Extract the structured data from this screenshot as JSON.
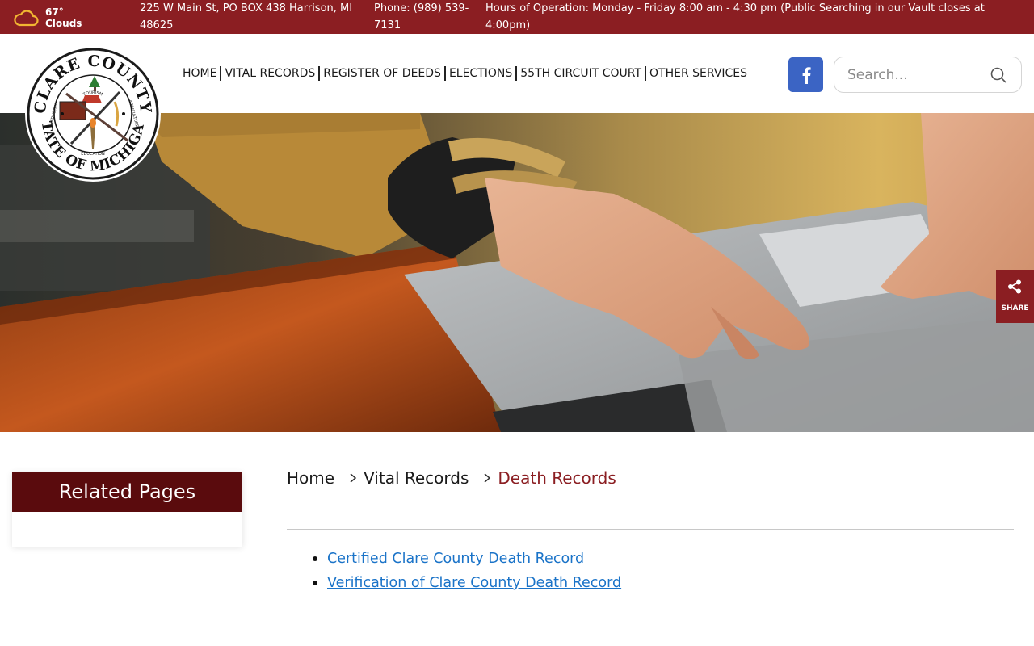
{
  "topbar": {
    "weather": {
      "temp": "67°",
      "condition": "Clouds",
      "icon": "cloud-icon"
    },
    "address": "225 W Main St, PO BOX 438 Harrison, MI 48625",
    "phone": "Phone: (989) 539-7131",
    "hours": "Hours of Operation: Monday - Friday 8:00 am - 4:30 pm  (Public Searching in our Vault closes at 4:00pm)"
  },
  "seal": {
    "top_text": "CLARE COUNTY",
    "bottom_text": "STATE OF MICHIGAN",
    "inner_words": [
      "TOURISM",
      "INDUSTRY",
      "AGRICULTURE",
      "EDUCATION"
    ]
  },
  "nav": {
    "items": [
      "HOME",
      "VITAL RECORDS",
      "REGISTER OF DEEDS",
      "ELECTIONS",
      "55TH CIRCUIT COURT",
      "OTHER SERVICES"
    ]
  },
  "social": {
    "facebook_icon": "facebook-icon"
  },
  "search": {
    "placeholder": "Search..."
  },
  "share": {
    "label": "SHARE",
    "icon": "share-icon"
  },
  "sidebar": {
    "title": "Related Pages"
  },
  "breadcrumb": {
    "home": "Home",
    "parent": "Vital Records",
    "current": "Death Records"
  },
  "content": {
    "links": [
      "Certified Clare County Death Record",
      "Verification of Clare County Death Record"
    ]
  },
  "colors": {
    "brand": "#8b1e22",
    "sidebar_head": "#5a0b0d",
    "link": "#1a73c8",
    "facebook": "#3b64c4"
  }
}
